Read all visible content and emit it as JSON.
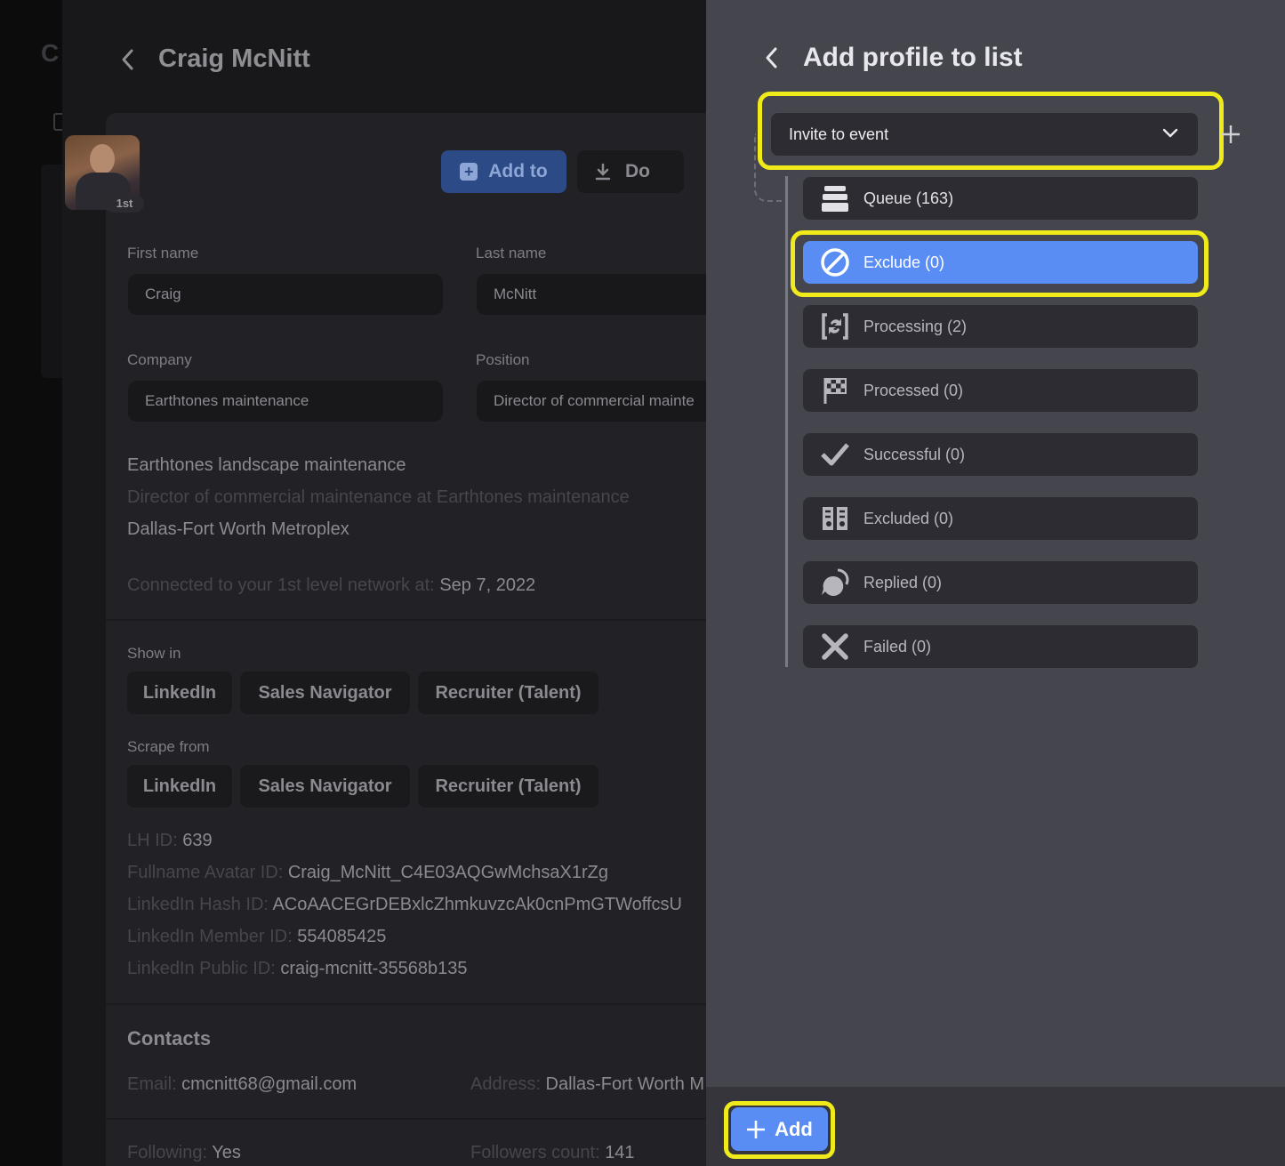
{
  "background_app": {
    "title_fragment": "C"
  },
  "profile": {
    "back_icon": "chevron-left-icon",
    "name": "Craig McNitt",
    "connection_badge": "1st",
    "add_to_label": "Add to",
    "download_label": "Do",
    "fields": {
      "first_name_label": "First name",
      "first_name": "Craig",
      "last_name_label": "Last name",
      "last_name": "McNitt",
      "company_label": "Company",
      "company": "Earthtones maintenance",
      "position_label": "Position",
      "position": "Director of commercial mainte"
    },
    "headline": "Earthtones landscape maintenance",
    "subheadline": "Director of commercial maintenance at Earthtones maintenance",
    "location": "Dallas-Fort Worth Metroplex",
    "connected_label": "Connected to your 1st level network at:",
    "connected_date": "Sep 7, 2022",
    "show_in_label": "Show in",
    "show_in": [
      "LinkedIn",
      "Sales Navigator",
      "Recruiter (Talent)"
    ],
    "scrape_from_label": "Scrape from",
    "scrape_from": [
      "LinkedIn",
      "Sales Navigator",
      "Recruiter (Talent)"
    ],
    "ids": [
      {
        "label": "LH ID:",
        "value": "639"
      },
      {
        "label": "Fullname Avatar ID:",
        "value": "Craig_McNitt_C4E03AQGwMchsaX1rZg"
      },
      {
        "label": "LinkedIn Hash ID:",
        "value": "ACoAACEGrDEBxlcZhmkuvzcAk0cnPmGTWoffcsU"
      },
      {
        "label": "LinkedIn Member ID:",
        "value": "554085425"
      },
      {
        "label": "LinkedIn Public ID:",
        "value": "craig-mcnitt-35568b135"
      }
    ],
    "contacts_heading": "Contacts",
    "email_label": "Email:",
    "email": "cmcnitt68@gmail.com",
    "address_label": "Address:",
    "address": "Dallas-Fort Worth M",
    "following_label": "Following:",
    "following": "Yes",
    "followers_label": "Followers count:",
    "followers": "141"
  },
  "panel": {
    "back_icon": "chevron-left-icon",
    "title": "Add profile to list",
    "dropdown_value": "Invite to event",
    "add_list_icon": "plus-icon",
    "items": [
      {
        "label": "Queue (163)",
        "icon": "queue-stack-icon"
      },
      {
        "label": "Exclude (0)",
        "icon": "ban-icon",
        "selected": true
      },
      {
        "label": "Processing (2)",
        "icon": "processing-refresh-icon"
      },
      {
        "label": "Processed (0)",
        "icon": "checkered-flag-icon"
      },
      {
        "label": "Successful (0)",
        "icon": "checkmark-icon"
      },
      {
        "label": "Excluded (0)",
        "icon": "excluded-people-icon"
      },
      {
        "label": "Replied (0)",
        "icon": "chat-bubble-icon"
      },
      {
        "label": "Failed (0)",
        "icon": "x-mark-icon"
      }
    ],
    "add_button_label": "Add"
  },
  "colors": {
    "accent": "#5a8df3",
    "highlight": "#f0ea1a",
    "panel_bg": "#45454d"
  }
}
